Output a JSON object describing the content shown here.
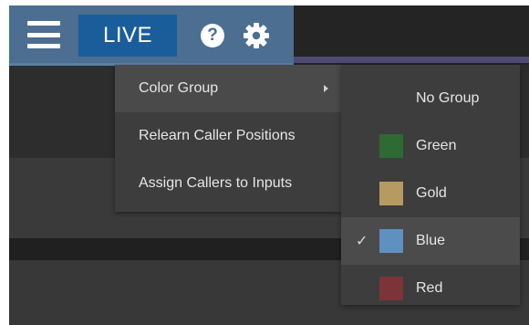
{
  "toolbar": {
    "menu_icon": "hamburger-menu-icon",
    "live_label": "LIVE",
    "help_icon": "help-icon",
    "help_glyph": "?",
    "settings_icon": "gear-icon"
  },
  "colors": {
    "toolbar_bg": "#4c6e91",
    "live_button_bg": "#1a5d9b",
    "menu_bg": "#3d3d3d"
  },
  "menu": {
    "items": [
      {
        "label": "Color Group",
        "has_submenu": true
      },
      {
        "label": "Relearn Caller Positions"
      },
      {
        "label": "Assign Callers to Inputs"
      }
    ]
  },
  "submenu": {
    "items": [
      {
        "label": "No Group",
        "color": null,
        "selected": false
      },
      {
        "label": "Green",
        "color": "#2e6a33",
        "selected": false
      },
      {
        "label": "Gold",
        "color": "#b79a62",
        "selected": false
      },
      {
        "label": "Blue",
        "color": "#5f90c0",
        "selected": true,
        "check": "✓"
      },
      {
        "label": "Red",
        "color": "#7d3438",
        "selected": false
      }
    ]
  }
}
